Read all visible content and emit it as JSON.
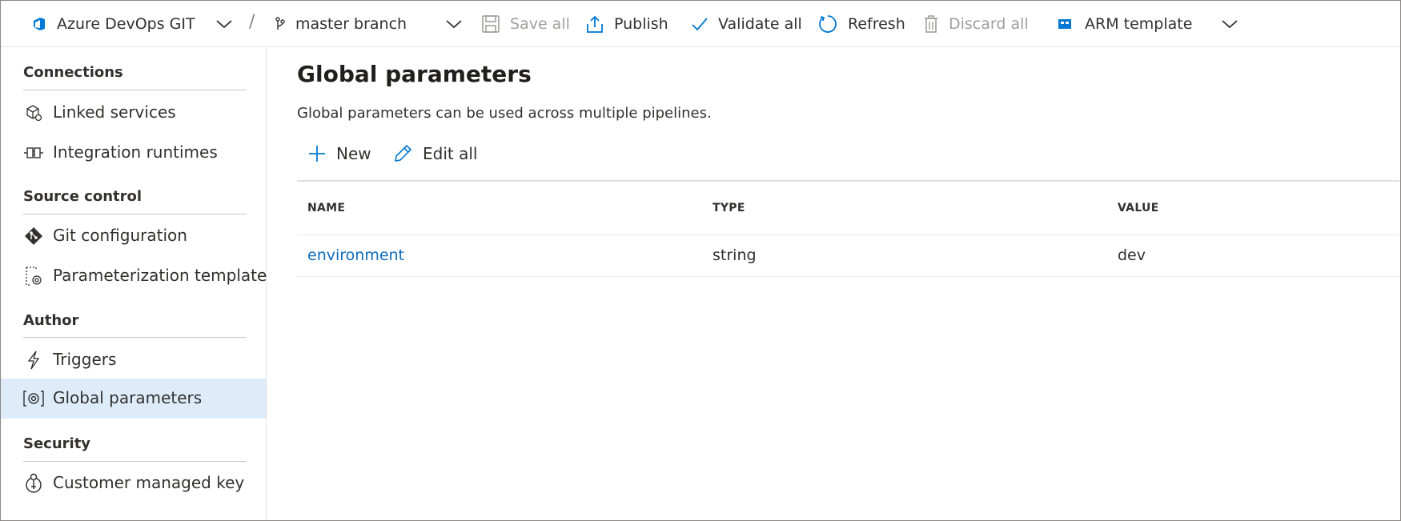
{
  "toolbar": {
    "repo_label": "Azure DevOps GIT",
    "path_separator": "/",
    "branch_label": "master branch",
    "save_all_label": "Save all",
    "publish_label": "Publish",
    "validate_all_label": "Validate all",
    "refresh_label": "Refresh",
    "discard_all_label": "Discard all",
    "arm_template_label": "ARM template"
  },
  "sidebar": {
    "sections": [
      {
        "header": "Connections",
        "items": [
          {
            "label": "Linked services",
            "icon": "linked-services-icon"
          },
          {
            "label": "Integration runtimes",
            "icon": "integration-runtime-icon"
          }
        ]
      },
      {
        "header": "Source control",
        "items": [
          {
            "label": "Git configuration",
            "icon": "git-icon"
          },
          {
            "label": "Parameterization template",
            "icon": "parameterization-template-icon"
          }
        ]
      },
      {
        "header": "Author",
        "items": [
          {
            "label": "Triggers",
            "icon": "trigger-icon"
          },
          {
            "label": "Global parameters",
            "icon": "global-parameters-icon",
            "selected": true
          }
        ]
      },
      {
        "header": "Security",
        "items": [
          {
            "label": "Customer managed key",
            "icon": "key-icon"
          }
        ]
      }
    ]
  },
  "main": {
    "title": "Global parameters",
    "description": "Global parameters can be used across multiple pipelines.",
    "commands": {
      "new_label": "New",
      "edit_all_label": "Edit all"
    },
    "table": {
      "columns": [
        "NAME",
        "TYPE",
        "VALUE"
      ],
      "rows": [
        {
          "name": "environment",
          "type": "string",
          "value": "dev"
        }
      ]
    }
  },
  "colors": {
    "accent": "#0f6cbd",
    "selected_bg": "#deecf9",
    "disabled_text": "#a19f9d"
  }
}
